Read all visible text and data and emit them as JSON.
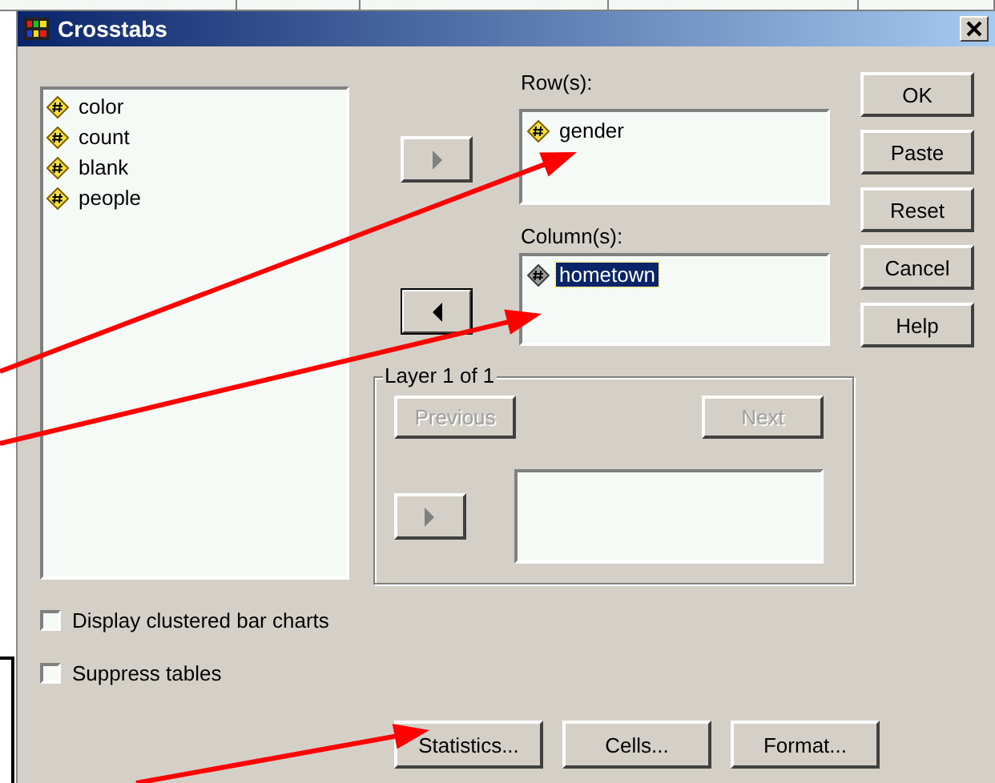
{
  "window": {
    "title": "Crosstabs"
  },
  "variables": [
    {
      "name": "color",
      "selected": false
    },
    {
      "name": "count",
      "selected": false
    },
    {
      "name": "blank",
      "selected": false
    },
    {
      "name": "people",
      "selected": false
    }
  ],
  "rows_label": "Row(s):",
  "rows": [
    {
      "name": "gender",
      "selected": false
    }
  ],
  "columns_label": "Column(s):",
  "columns": [
    {
      "name": "hometown",
      "selected": true
    }
  ],
  "arrow_buttons": [
    {
      "kind": "right",
      "disabled": true
    },
    {
      "kind": "left",
      "disabled": false
    }
  ],
  "layer": {
    "title": "Layer 1 of 1",
    "previous": {
      "label": "Previous",
      "disabled": true
    },
    "next": {
      "label": "Next",
      "disabled": true
    },
    "arrow": {
      "kind": "right",
      "disabled": true
    }
  },
  "side_buttons": [
    "OK",
    "Paste",
    "Reset",
    "Cancel",
    "Help"
  ],
  "options": [
    {
      "label": "Display clustered bar charts",
      "checked": false
    },
    {
      "label": "Suppress tables",
      "checked": false
    }
  ],
  "bottom_buttons": [
    "Statistics...",
    "Cells...",
    "Format..."
  ]
}
